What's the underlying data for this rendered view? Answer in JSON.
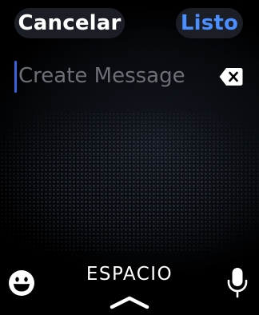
{
  "header": {
    "cancel_label": "Cancelar",
    "done_label": "Listo"
  },
  "message_field": {
    "value": "",
    "placeholder": "Create Message"
  },
  "keyboard": {
    "space_label": "ESPACIO"
  },
  "icons": {
    "backspace": "backspace-icon",
    "emoji": "emoji-icon",
    "microphone": "microphone-icon",
    "expand": "chevron-up-icon"
  },
  "colors": {
    "accent": "#4a8eff",
    "cursor": "#3a63e0",
    "placeholder": "#6c7076",
    "pill_background": "#1b1e24"
  }
}
